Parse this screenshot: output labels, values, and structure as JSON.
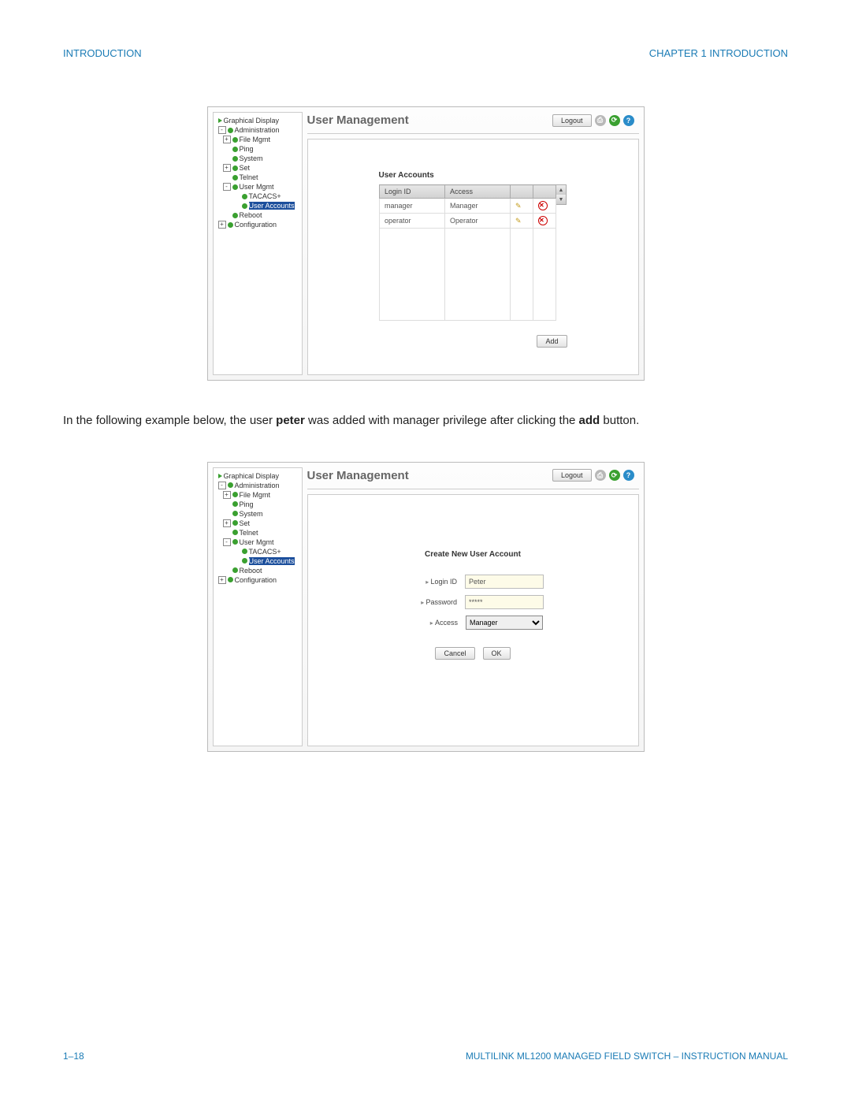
{
  "header": {
    "left": "INTRODUCTION",
    "right": "CHAPTER 1  INTRODUCTION"
  },
  "footer": {
    "left": "1–18",
    "right": "MULTILINK ML1200 MANAGED FIELD SWITCH – INSTRUCTION MANUAL"
  },
  "body_text_prefix": "In the following example below, the user ",
  "body_text_bold1": "peter",
  "body_text_mid": " was added with manager privilege after clicking the ",
  "body_text_bold2": "add",
  "body_text_suffix": " button.",
  "tree": {
    "graphical_display": "Graphical Display",
    "administration": "Administration",
    "file_mgmt": "File Mgmt",
    "ping": "Ping",
    "system": "System",
    "set": "Set",
    "telnet": "Telnet",
    "user_mgmt": "User Mgmt",
    "tacacs": "TACACS+",
    "user_accounts": "User Accounts",
    "reboot": "Reboot",
    "configuration": "Configuration"
  },
  "common": {
    "page_title": "User Management",
    "logout": "Logout",
    "add": "Add",
    "save_icon": "✎",
    "refresh_icon": "⟳",
    "help_icon": "?"
  },
  "scr1": {
    "section_title": "User Accounts",
    "headers": {
      "login": "Login ID",
      "access": "Access"
    },
    "rows": [
      {
        "login": "manager",
        "access": "Manager"
      },
      {
        "login": "operator",
        "access": "Operator"
      }
    ]
  },
  "scr2": {
    "form_title": "Create New User Account",
    "labels": {
      "login": "Login ID",
      "password": "Password",
      "access": "Access"
    },
    "values": {
      "login": "Peter",
      "password": "*****",
      "access": "Manager"
    },
    "buttons": {
      "cancel": "Cancel",
      "ok": "OK"
    }
  }
}
